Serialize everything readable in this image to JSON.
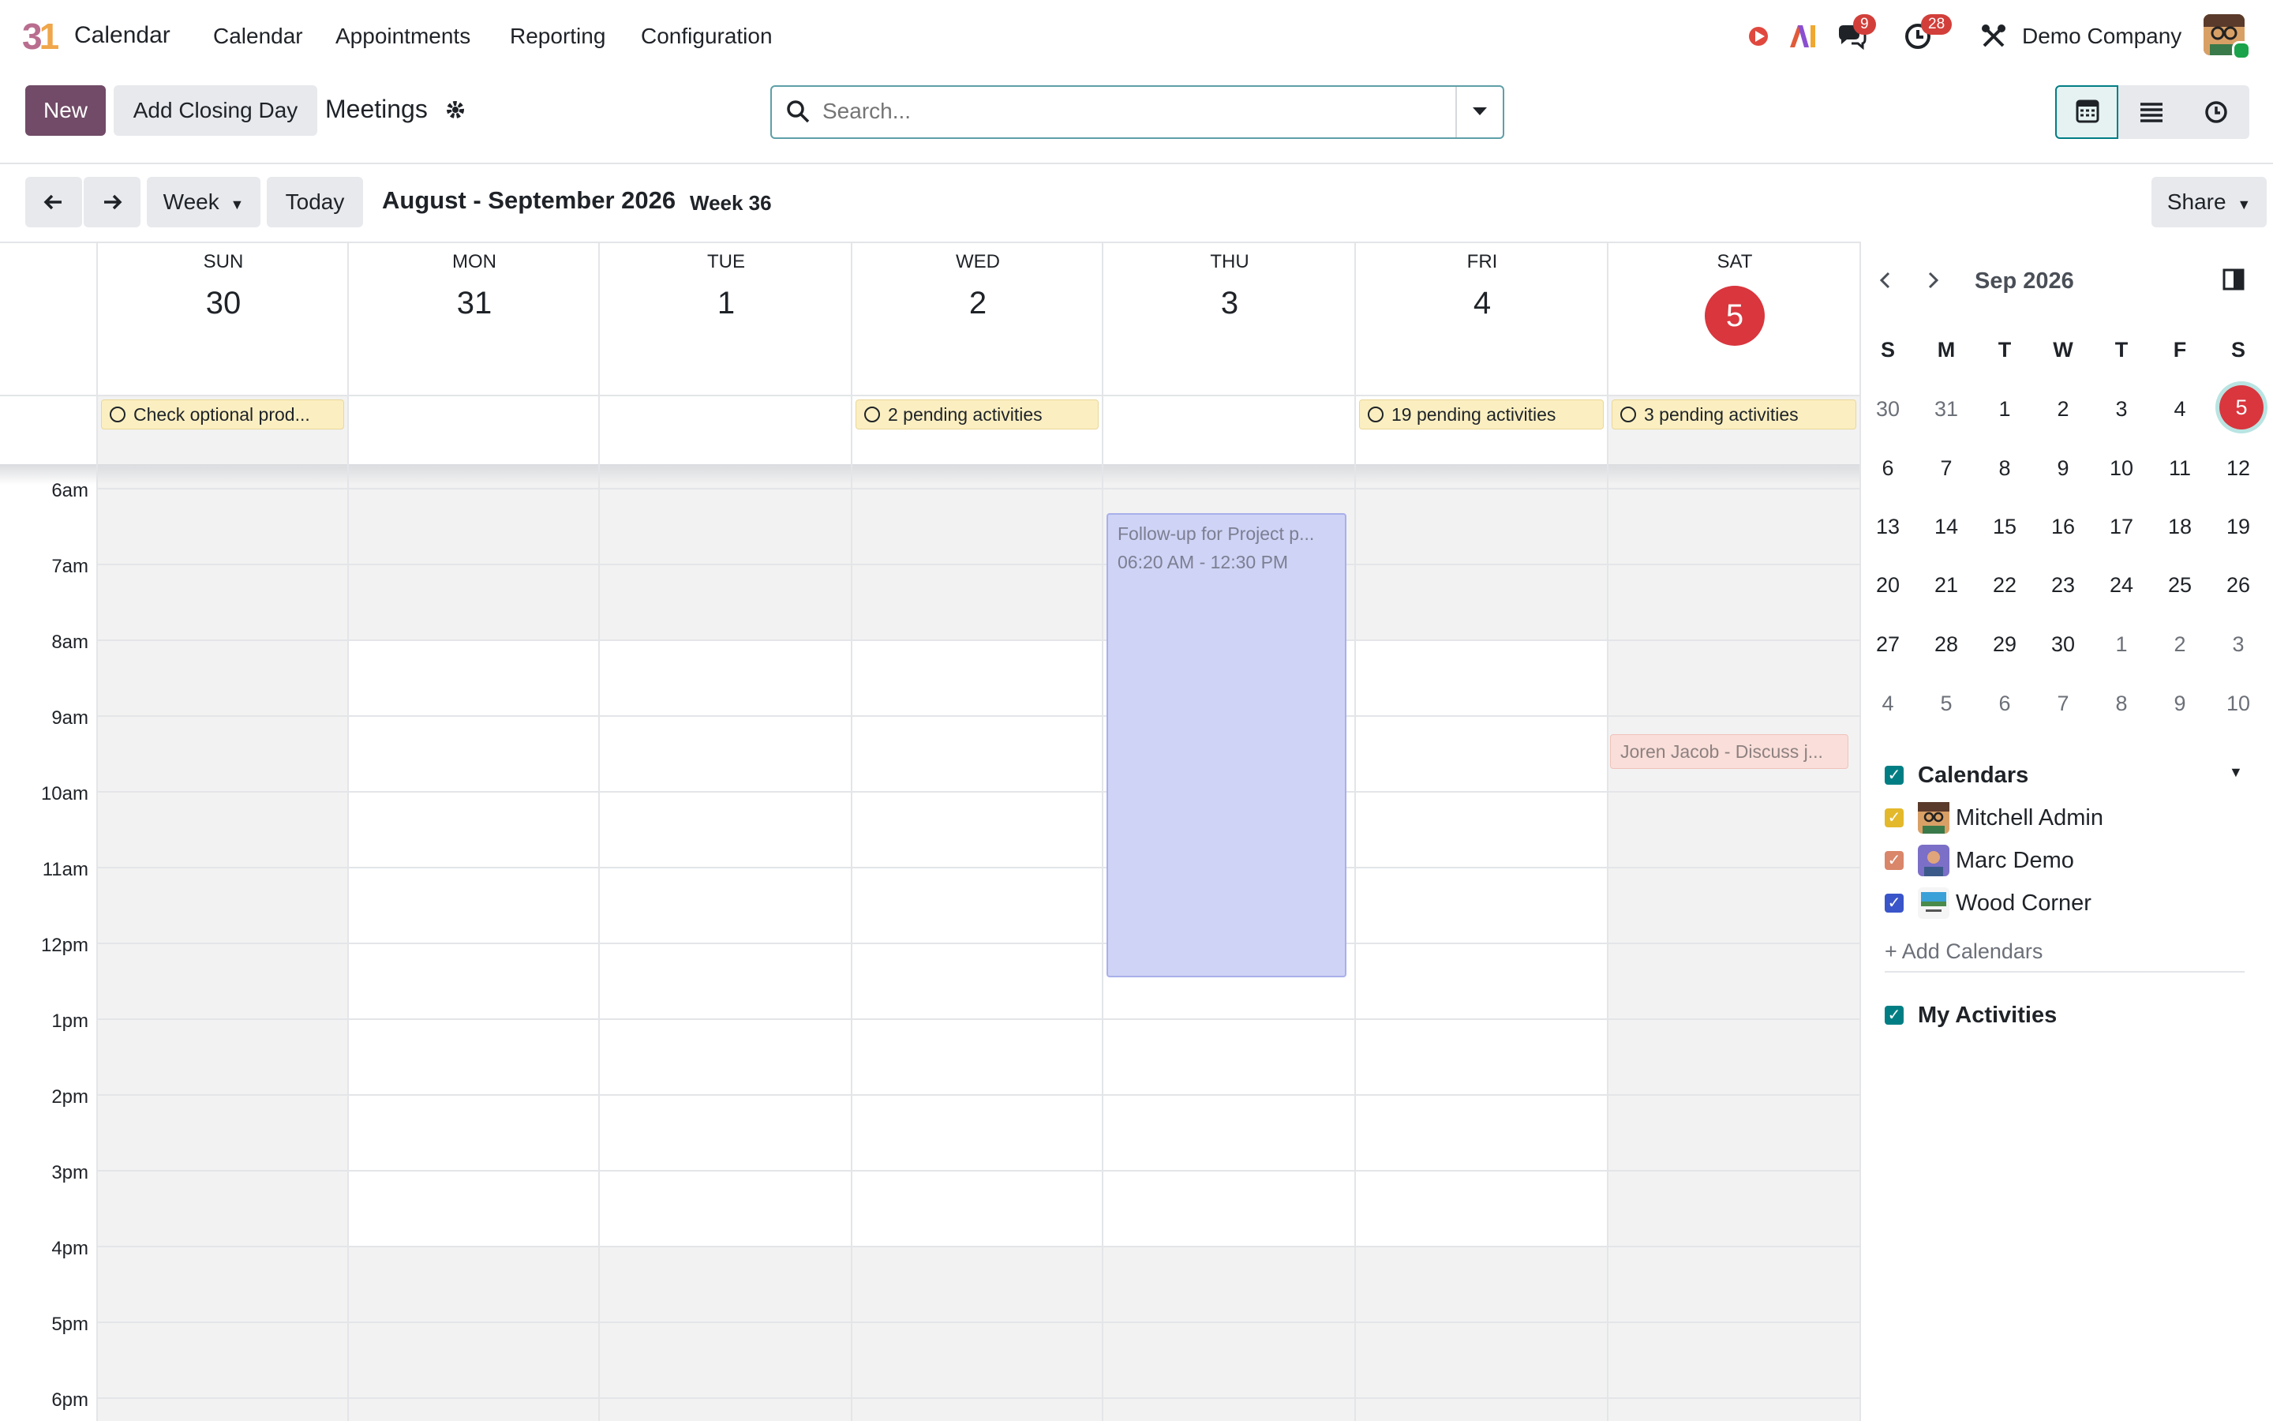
{
  "navbar": {
    "app_title": "Calendar",
    "menu": [
      "Calendar",
      "Appointments",
      "Reporting",
      "Configuration"
    ],
    "messages_badge": "9",
    "activities_badge": "28",
    "company": "Demo Company"
  },
  "control": {
    "new_label": "New",
    "closing_day_label": "Add Closing Day",
    "breadcrumb": "Meetings",
    "search_placeholder": "Search...",
    "share_label": "Share"
  },
  "toolbar": {
    "scale_label": "Week",
    "today_label": "Today",
    "range_title": "August - September 2026",
    "week_label": "Week 36"
  },
  "days": [
    {
      "name": "SUN",
      "num": "30"
    },
    {
      "name": "MON",
      "num": "31"
    },
    {
      "name": "TUE",
      "num": "1"
    },
    {
      "name": "WED",
      "num": "2"
    },
    {
      "name": "THU",
      "num": "3"
    },
    {
      "name": "FRI",
      "num": "4"
    },
    {
      "name": "SAT",
      "num": "5"
    }
  ],
  "allday": {
    "sun": "Check optional prod...",
    "wed": "2 pending activities",
    "fri": "19 pending activities",
    "sat": "3 pending activities"
  },
  "hours": [
    "6am",
    "7am",
    "8am",
    "9am",
    "10am",
    "11am",
    "12pm",
    "1pm",
    "2pm",
    "3pm",
    "4pm",
    "5pm",
    "6pm"
  ],
  "events": {
    "blue_title": "Follow-up for Project p...",
    "blue_time": "06:20 AM - 12:30 PM",
    "red_title": "Joren Jacob - Discuss j..."
  },
  "mini_calendar": {
    "title": "Sep 2026",
    "dow": [
      "S",
      "M",
      "T",
      "W",
      "T",
      "F",
      "S"
    ],
    "weeks": [
      [
        "30",
        "31",
        "1",
        "2",
        "3",
        "4",
        "5"
      ],
      [
        "6",
        "7",
        "8",
        "9",
        "10",
        "11",
        "12"
      ],
      [
        "13",
        "14",
        "15",
        "16",
        "17",
        "18",
        "19"
      ],
      [
        "20",
        "21",
        "22",
        "23",
        "24",
        "25",
        "26"
      ],
      [
        "27",
        "28",
        "29",
        "30",
        "1",
        "2",
        "3"
      ],
      [
        "4",
        "5",
        "6",
        "7",
        "8",
        "9",
        "10"
      ]
    ]
  },
  "filters": {
    "calendars_title": "Calendars",
    "items": [
      "Mitchell Admin",
      "Marc Demo",
      "Wood Corner"
    ],
    "add_label": "+ Add Calendars",
    "activities_title": "My Activities"
  },
  "colors": {
    "brand": "#714b67",
    "today_red": "#d9363e",
    "teal": "#017e84",
    "mitchell": "#e3b82b",
    "marc": "#d9866a",
    "wood": "#3a55c9"
  }
}
